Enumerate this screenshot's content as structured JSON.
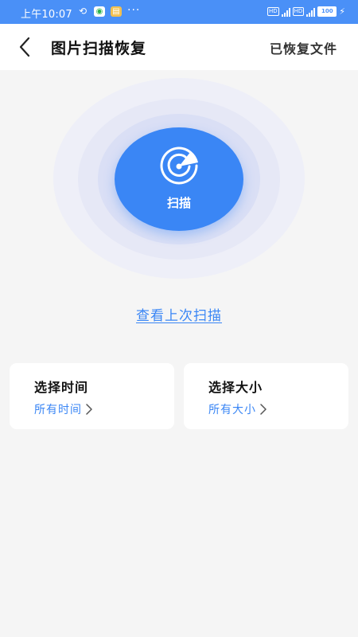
{
  "status_bar": {
    "time": "上午10:07",
    "network_badge": "HD",
    "network_type": "4G",
    "battery": "100"
  },
  "header": {
    "title": "图片扫描恢复",
    "action_label": "已恢复文件",
    "back_icon": "chevron-left-icon"
  },
  "scan": {
    "button_label": "扫描",
    "icon": "radar-icon",
    "last_scan_link": "查看上次扫描"
  },
  "filters": [
    {
      "title": "选择时间",
      "value": "所有时间"
    },
    {
      "title": "选择大小",
      "value": "所有大小"
    }
  ],
  "colors": {
    "accent": "#3a86f5",
    "status_bar": "#4a90f7",
    "background": "#f5f5f5"
  }
}
